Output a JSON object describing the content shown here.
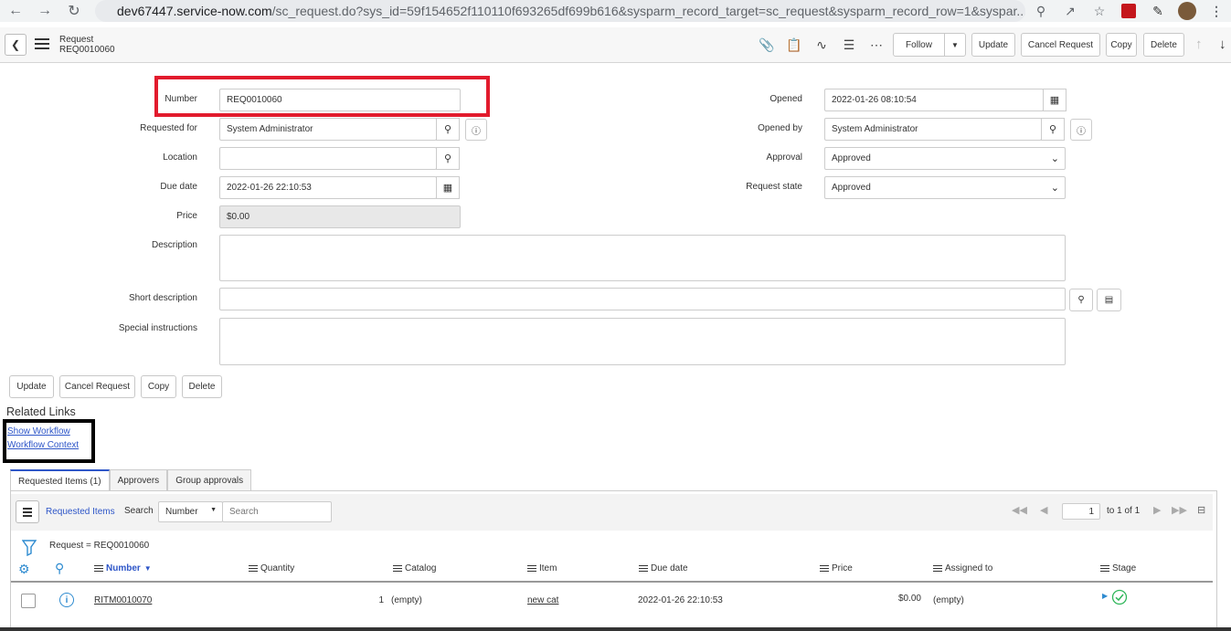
{
  "browser": {
    "url_host": "dev67447.service-now.com",
    "url_path": "/sc_request.do?sys_id=59f154652f110110f693265df699b616&sysparm_record_target=sc_request&sysparm_record_row=1&syspar..."
  },
  "header": {
    "record_type": "Request",
    "record_number": "REQ0010060",
    "follow_label": "Follow",
    "update_label": "Update",
    "cancel_request_label": "Cancel Request",
    "copy_label": "Copy",
    "delete_label": "Delete"
  },
  "form": {
    "number": {
      "label": "Number",
      "value": "REQ0010060"
    },
    "requested_for": {
      "label": "Requested for",
      "value": "System Administrator"
    },
    "location": {
      "label": "Location",
      "value": ""
    },
    "due_date": {
      "label": "Due date",
      "value": "2022-01-26 22:10:53"
    },
    "price": {
      "label": "Price",
      "value": "$0.00"
    },
    "description": {
      "label": "Description",
      "value": ""
    },
    "short_description": {
      "label": "Short description",
      "value": ""
    },
    "special_instructions": {
      "label": "Special instructions",
      "value": ""
    },
    "opened": {
      "label": "Opened",
      "value": "2022-01-26 08:10:54"
    },
    "opened_by": {
      "label": "Opened by",
      "value": "System Administrator"
    },
    "approval": {
      "label": "Approval",
      "value": "Approved"
    },
    "request_state": {
      "label": "Request state",
      "value": "Approved"
    }
  },
  "form_buttons": {
    "update": "Update",
    "cancel_request": "Cancel Request",
    "copy": "Copy",
    "delete": "Delete"
  },
  "related_links": {
    "title": "Related Links",
    "show_workflow": "Show Workflow",
    "workflow_context": "Workflow Context"
  },
  "tabs": [
    "Requested Items (1)",
    "Approvers",
    "Group approvals"
  ],
  "list": {
    "title": "Requested Items",
    "search_label": "Search",
    "search_field": "Number",
    "search_placeholder": "Search",
    "page_input": "1",
    "page_text": "to 1 of 1",
    "filter": "Request = REQ0010060",
    "columns": [
      "Number",
      "Quantity",
      "Catalog",
      "Item",
      "Due date",
      "Price",
      "Assigned to",
      "Stage"
    ],
    "rows": [
      {
        "number": "RITM0010070",
        "quantity": "1",
        "catalog": "(empty)",
        "item": "new cat",
        "due_date": "2022-01-26 22:10:53",
        "price": "$0.00",
        "assigned_to": "(empty)"
      }
    ]
  },
  "colors": {
    "highlight_red": "#e21b2d",
    "link_blue": "#2e56c8",
    "stage_green": "#2fb65a"
  }
}
